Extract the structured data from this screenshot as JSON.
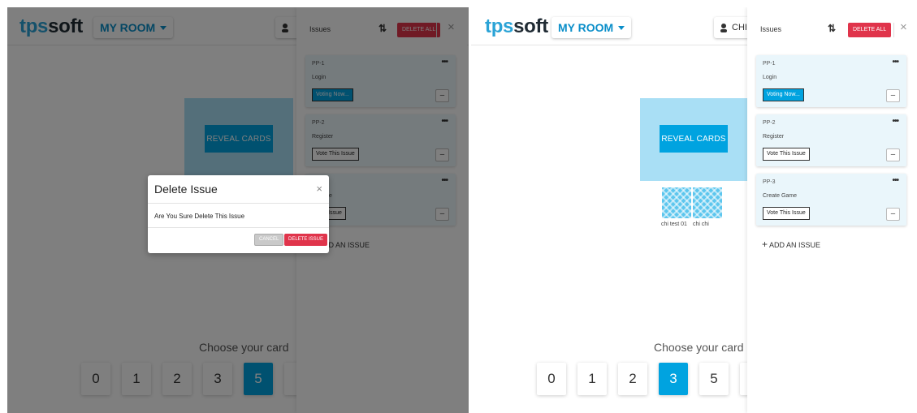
{
  "app": {
    "logo_prefix": "tps",
    "logo_suffix": "soft",
    "room_label": "MY ROOM",
    "user_label_partial": "CHI"
  },
  "board": {
    "reveal_label": "REVEAL CARDS",
    "players": [
      "chi test 01",
      "chi chi"
    ]
  },
  "deck": {
    "prompt": "Choose your card",
    "cards": [
      "0",
      "1",
      "2",
      "3",
      "5"
    ],
    "left_selected": "5",
    "right_selected": "3"
  },
  "sidebar": {
    "title": "Issues",
    "delete_all_label": "DELETE ALL",
    "sort_icon": "swap-vertical-icon",
    "close_icon": "close-icon",
    "issues": [
      {
        "key": "PP-1",
        "name": "Login",
        "vote_label": "Voting Now...",
        "voting": true
      },
      {
        "key": "PP-2",
        "name": "Register",
        "vote_label": "Vote This Issue",
        "voting": false
      },
      {
        "key": "PP-3",
        "name": "Create Game",
        "vote_label": "Vote This Issue",
        "voting": false
      }
    ],
    "left_partial": {
      "issue3_name": "e Game",
      "issue3_vote": "This Issue",
      "add_label": "ADD AN ISSUE"
    },
    "add_label": "ADD AN ISSUE"
  },
  "modal": {
    "title": "Delete Issue",
    "message": "Are You Sure Delete This Issue",
    "cancel_label": "CANCEL",
    "delete_label": "DELETE ISSUE"
  },
  "colors": {
    "brand_blue": "#00a3e0",
    "board_light": "#a9dff5",
    "danger": "#e0344b",
    "overlay": "rgba(0,0,0,0.5)"
  }
}
